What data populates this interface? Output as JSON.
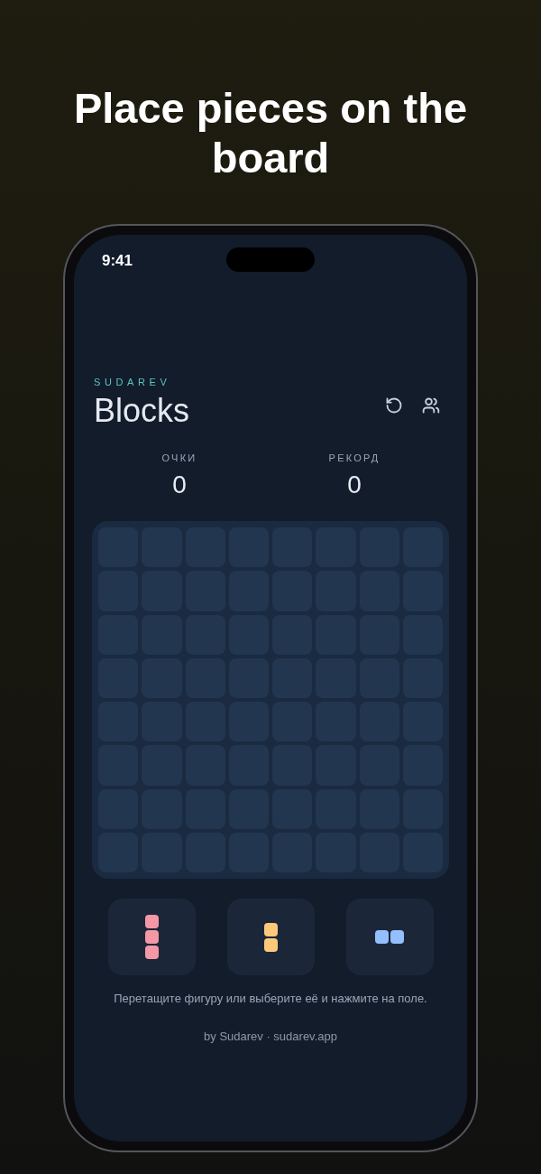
{
  "headline": "Place pieces on the board",
  "status_bar": {
    "time": "9:41"
  },
  "header": {
    "brand": "SUDAREV",
    "title": "Blocks"
  },
  "stats": [
    {
      "label": "ОЧКИ",
      "value": "0"
    },
    {
      "label": "РЕКОРД",
      "value": "0"
    }
  ],
  "board": {
    "cells": [
      [
        {
          "filled": false
        },
        {
          "filled": false
        },
        {
          "filled": false
        },
        {
          "filled": false
        },
        {
          "filled": false
        },
        {
          "filled": false
        },
        {
          "filled": false
        },
        {
          "filled": false
        }
      ],
      [
        {
          "filled": false
        },
        {
          "filled": false
        },
        {
          "filled": false
        },
        {
          "filled": false
        },
        {
          "filled": false
        },
        {
          "filled": false
        },
        {
          "filled": false
        },
        {
          "filled": false
        }
      ],
      [
        {
          "filled": false
        },
        {
          "filled": false
        },
        {
          "filled": false
        },
        {
          "filled": false
        },
        {
          "filled": false
        },
        {
          "filled": false
        },
        {
          "filled": false
        },
        {
          "filled": false
        }
      ],
      [
        {
          "filled": false
        },
        {
          "filled": false
        },
        {
          "filled": false
        },
        {
          "filled": false
        },
        {
          "filled": false
        },
        {
          "filled": false
        },
        {
          "filled": false
        },
        {
          "filled": false
        }
      ],
      [
        {
          "filled": false
        },
        {
          "filled": false
        },
        {
          "filled": false
        },
        {
          "filled": false
        },
        {
          "filled": false
        },
        {
          "filled": false
        },
        {
          "filled": false
        },
        {
          "filled": false
        }
      ],
      [
        {
          "filled": false
        },
        {
          "filled": false
        },
        {
          "filled": false
        },
        {
          "filled": false
        },
        {
          "filled": false
        },
        {
          "filled": false
        },
        {
          "filled": false
        },
        {
          "filled": false
        }
      ],
      [
        {
          "filled": false
        },
        {
          "filled": false
        },
        {
          "filled": false
        },
        {
          "filled": false
        },
        {
          "filled": false
        },
        {
          "filled": false
        },
        {
          "filled": false
        },
        {
          "filled": false
        }
      ],
      [
        {
          "filled": false
        },
        {
          "filled": false
        },
        {
          "filled": false
        },
        {
          "filled": false
        },
        {
          "filled": false
        },
        {
          "filled": false
        },
        {
          "filled": false
        },
        {
          "filled": false
        }
      ]
    ]
  },
  "pieces": [
    {
      "color": "#f497a6",
      "shape": [
        [
          true
        ],
        [
          true
        ],
        [
          true
        ]
      ]
    },
    {
      "color": "#fcc97a",
      "shape": [
        [
          true
        ],
        [
          true
        ]
      ]
    },
    {
      "color": "#93bffc",
      "shape": [
        [
          true,
          true
        ]
      ]
    }
  ],
  "hint": "Перетащите фигуру или выберите её и нажмите на поле.",
  "footer": "by Sudarev · sudarev.app"
}
